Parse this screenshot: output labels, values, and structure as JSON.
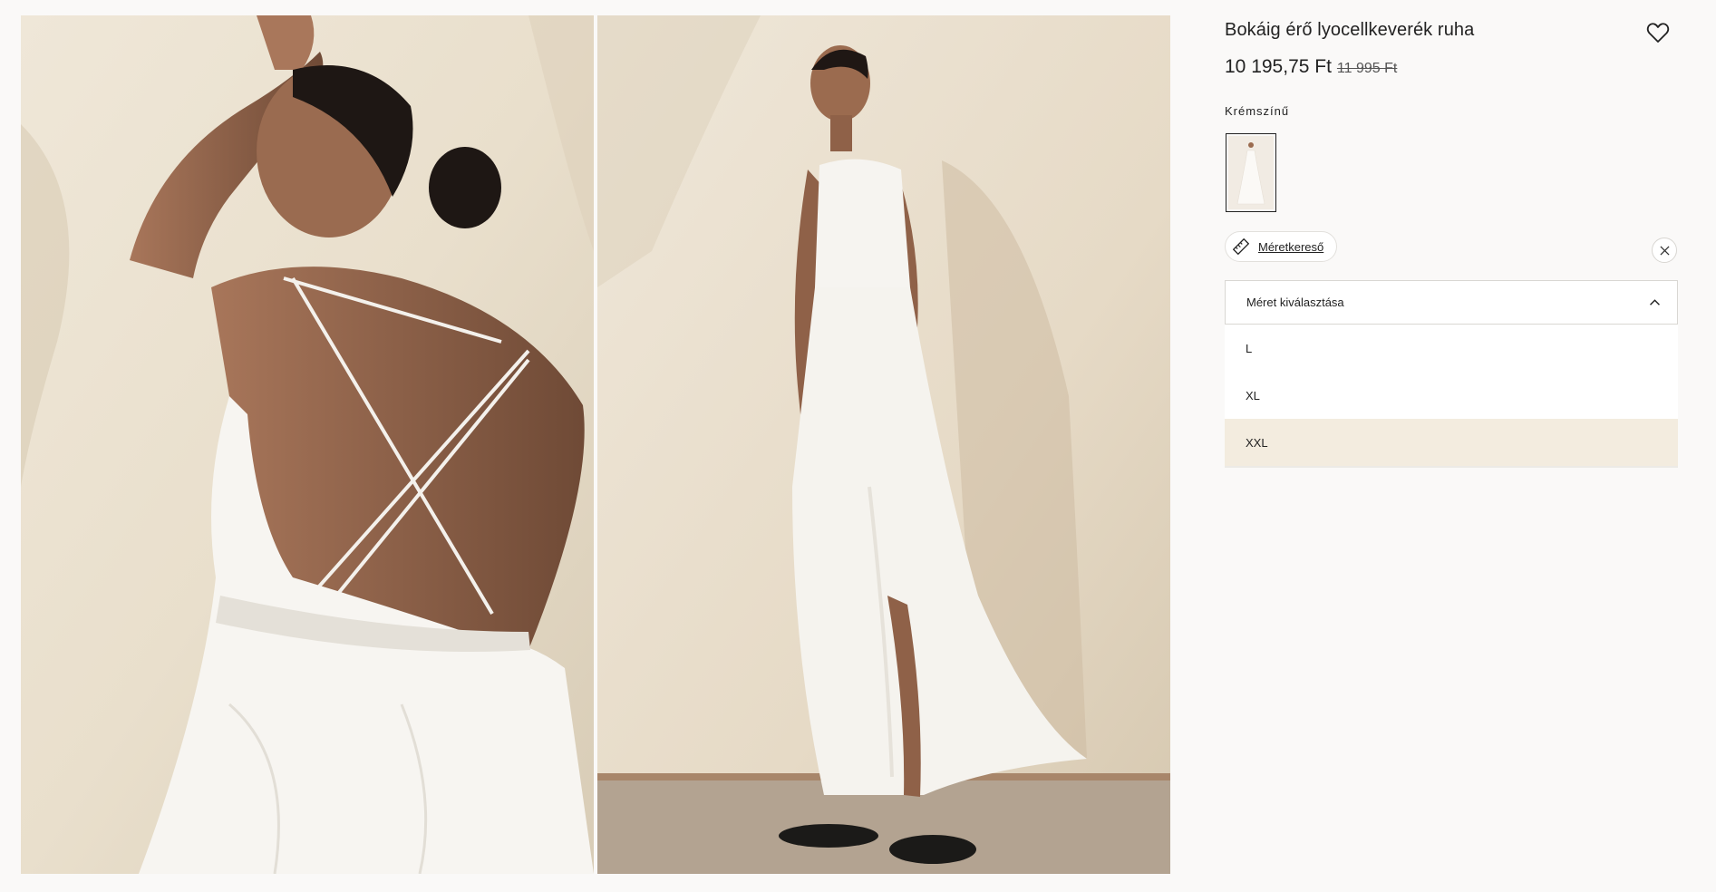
{
  "product": {
    "title": "Bokáig érő lyocellkeverék ruha",
    "price": "10 195,75 Ft",
    "old_price": "11 995 Ft",
    "color_label": "Krémszínű"
  },
  "size_finder": {
    "label": "Méretkereső"
  },
  "size_select": {
    "placeholder": "Méret kiválasztása",
    "options": [
      "L",
      "XL",
      "XXL"
    ],
    "highlighted": "XXL"
  },
  "colors": {
    "background": "#faf9f8",
    "text": "#222222",
    "highlight": "#f3ecdf"
  },
  "icons": [
    "heart-icon",
    "ruler-icon",
    "close-icon",
    "chevron-up-icon"
  ]
}
